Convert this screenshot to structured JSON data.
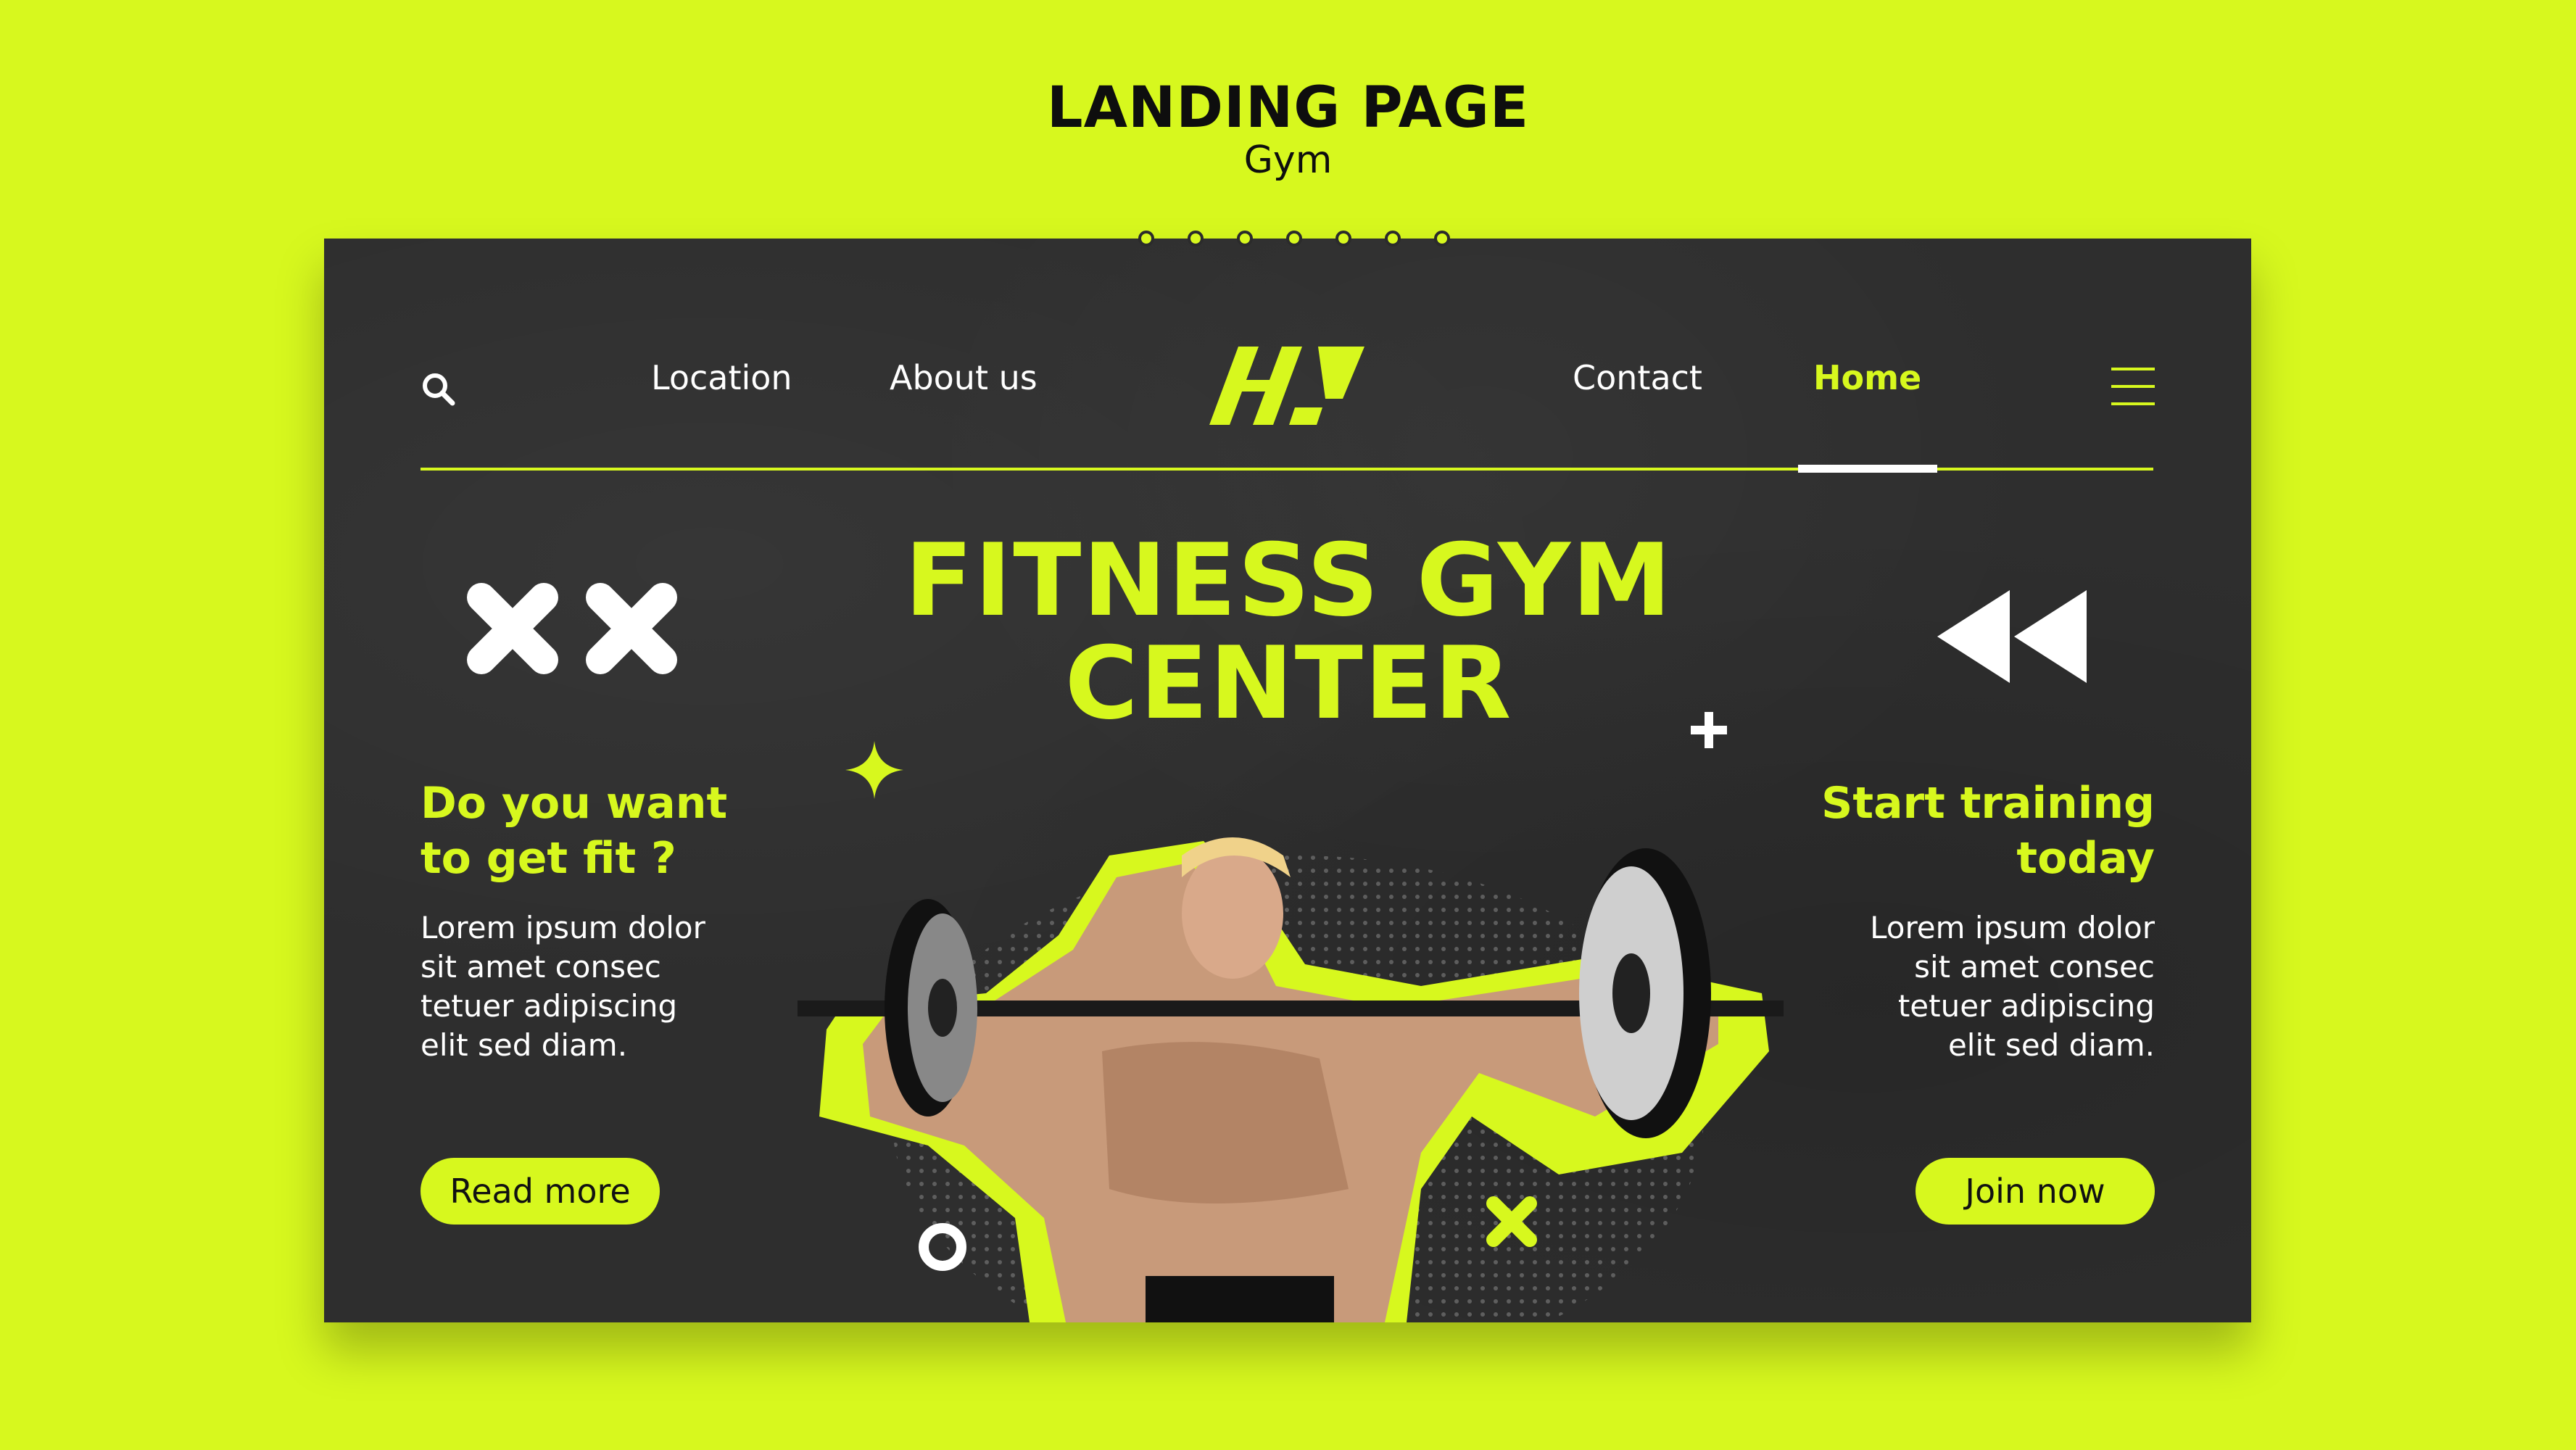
{
  "header": {
    "title": "LANDING PAGE",
    "subtitle": "Gym"
  },
  "nav": {
    "items": [
      {
        "label": "Location"
      },
      {
        "label": "About us"
      },
      {
        "label": "Contact"
      },
      {
        "label": "Home",
        "active": true
      }
    ],
    "logo": "logo-icon",
    "search_icon": "search-icon",
    "menu_icon": "hamburger-menu-icon"
  },
  "hero": {
    "title_line1": "FITNESS GYM",
    "title_line2": "CENTER"
  },
  "left": {
    "heading_line1": "Do you want",
    "heading_line2": "to get fit ?",
    "body": [
      "Lorem ipsum dolor",
      "sit amet consec",
      "tetuer adipiscing",
      "elit sed diam."
    ],
    "button": "Read more"
  },
  "right": {
    "heading_line1": "Start training",
    "heading_line2": "today",
    "body": [
      "Lorem ipsum dolor",
      "sit amet consec",
      "tetuer adipiscing",
      "elit sed diam."
    ],
    "button": "Join now"
  },
  "colors": {
    "accent": "#d7f81e",
    "card": "#2e2e2e",
    "text": "#ffffff",
    "dark": "#0e0e0e"
  }
}
